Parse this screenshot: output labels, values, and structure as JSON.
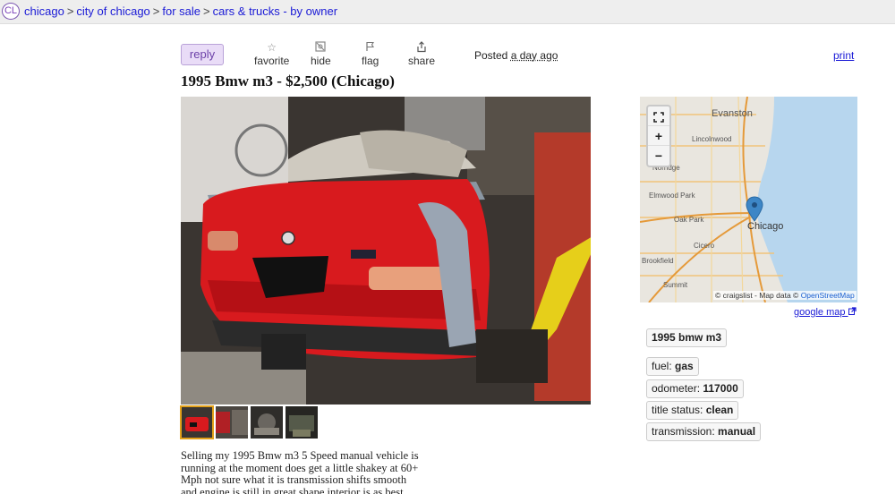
{
  "breadcrumb": {
    "logo": "CL",
    "items": [
      "chicago",
      "city of chicago",
      "for sale",
      "cars & trucks - by owner"
    ],
    "separator": ">"
  },
  "actions": {
    "reply": "reply",
    "favorite": "favorite",
    "hide": "hide",
    "flag": "flag",
    "share": "share",
    "posted_label": "Posted",
    "posted_when": "a day ago",
    "print": "print"
  },
  "listing": {
    "title": "1995 Bmw m3 - $2,500 (Chicago)",
    "thumbnail_count": 4,
    "body": "Selling my 1995 Bmw m3 5 Speed manual vehicle is running at the moment does get a little shakey at 60+ Mph not sure what it is transmission shifts smooth and engine is still in great shape interior is as best"
  },
  "map": {
    "labels": [
      "Evanston",
      "Lincolnwood",
      "Norridge",
      "Elmwood Park",
      "Oak Park",
      "Chicago",
      "Cicero",
      "Brookfield",
      "Summit"
    ],
    "attribution_prefix": "© craigslist - Map data ©",
    "attribution_link": "OpenStreetMap",
    "zoom_in": "+",
    "zoom_out": "−",
    "google_map": "google map"
  },
  "attributes": {
    "headline": "1995 bmw m3",
    "fuel_label": "fuel:",
    "fuel_value": "gas",
    "odometer_label": "odometer:",
    "odometer_value": "117000",
    "title_status_label": "title status:",
    "title_status_value": "clean",
    "transmission_label": "transmission:",
    "transmission_value": "manual"
  },
  "colors": {
    "link": "#1a1ad6",
    "reply_bg": "#e9dcf7",
    "car_red": "#d81a1e",
    "lake": "#b7d6ee",
    "pin": "#3d86c6"
  },
  "icons": [
    "star-icon",
    "hide-icon",
    "flag-icon",
    "share-icon",
    "fullscreen-icon",
    "map-pin-icon",
    "external-link-icon"
  ]
}
